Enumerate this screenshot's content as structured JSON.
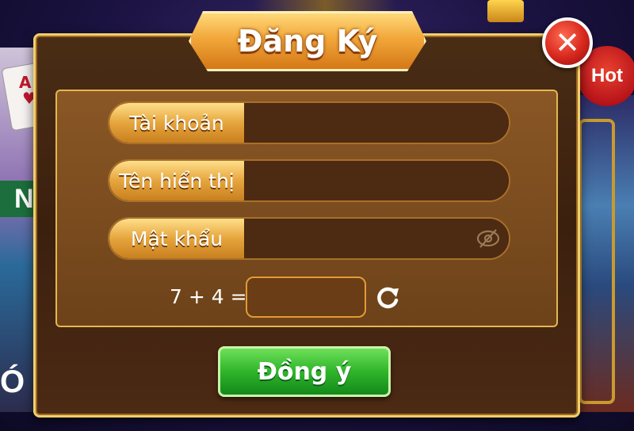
{
  "dialog": {
    "title": "Đăng Ký",
    "close_symbol": "✕"
  },
  "form": {
    "username": {
      "label": "Tài khoản",
      "value": "",
      "placeholder": ""
    },
    "display_name": {
      "label": "Tên hiển thị",
      "value": "",
      "placeholder": ""
    },
    "password": {
      "label": "Mật khẩu",
      "value": "",
      "placeholder": ""
    },
    "captcha": {
      "question": "7 + 4 =",
      "value": ""
    }
  },
  "buttons": {
    "submit_label": "Đồng ý"
  },
  "background": {
    "hot_badge": "Hot",
    "side_text_left": "NI",
    "side_text_bottom": "Ó",
    "card_rank": "A"
  },
  "icons": {
    "close": "close-icon",
    "password_toggle": "eye-slash-icon",
    "refresh": "refresh-icon"
  },
  "colors": {
    "gold": "#f1cf6c",
    "dialog_bg": "#3b200e",
    "label_gold": "#e6a53d",
    "submit_green": "#2fb52a",
    "close_red": "#d6271d"
  }
}
